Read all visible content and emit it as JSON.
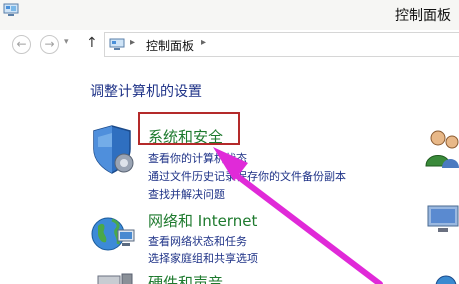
{
  "window": {
    "title": "控制面板"
  },
  "nav": {
    "back_glyph": "←",
    "forward_glyph": "→",
    "recent_glyph": "▾",
    "up_glyph": "↑",
    "address": {
      "sep_glyph": "▸",
      "location": "控制面板"
    }
  },
  "main": {
    "heading": "调整计算机的设置",
    "categories": [
      {
        "title": "系统和安全",
        "links": [
          "查看你的计算机状态",
          "通过文件历史记录保存你的文件备份副本",
          "查找并解决问题"
        ]
      },
      {
        "title": "网络和 Internet",
        "links": [
          "查看网络状态和任务",
          "选择家庭组和共享选项"
        ]
      },
      {
        "title": "硬件和声音",
        "links": []
      }
    ]
  },
  "annotation": {
    "box_color": "#b42a2a",
    "arrow_color": "#e02ad8"
  },
  "colors": {
    "category": "#1e7a2e",
    "link": "#1e3287"
  }
}
